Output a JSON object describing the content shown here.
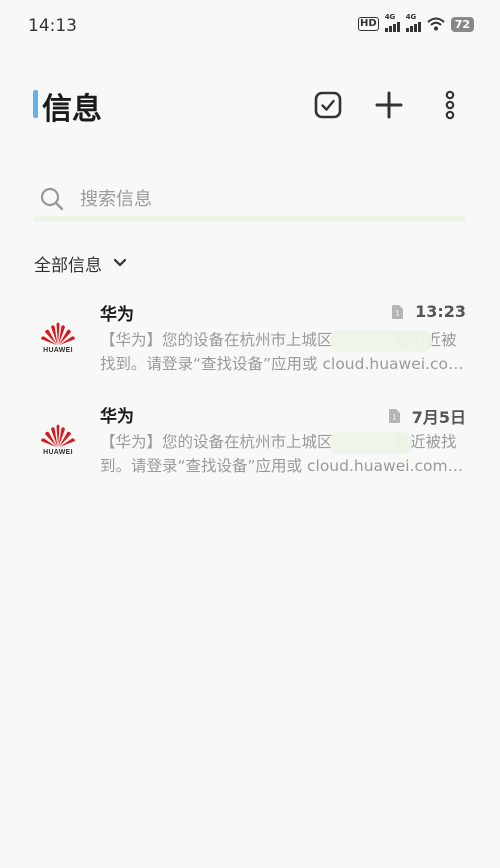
{
  "status_bar": {
    "time": "14:13",
    "hd_label": "HD",
    "network_1": "4G",
    "network_2": "4G",
    "battery": "72"
  },
  "header": {
    "title": "信息",
    "accent_color": "#5fb3e6",
    "actions": [
      {
        "name": "select",
        "icon": "check-square-icon"
      },
      {
        "name": "new",
        "icon": "plus-icon"
      },
      {
        "name": "more",
        "icon": "more-vertical-icon"
      }
    ]
  },
  "search": {
    "placeholder": "搜索信息",
    "value": ""
  },
  "filter": {
    "label": "全部信息"
  },
  "messages": [
    {
      "sender": "华为",
      "time": "13:23",
      "sim": "1",
      "preview": "【华为】您的设备在杭州市上城区　　　　街附近被找到。请登录“查找设备”应用或 cloud.huawei.com 查看",
      "logo_text": "HUAWEI"
    },
    {
      "sender": "华为",
      "time": "7月5日",
      "sim": "1",
      "preview": "【华为】您的设备在杭州市上城区　　　　附近被找到。请登录“查找设备”应用或 cloud.huawei.com 查看",
      "logo_text": "HUAWEI"
    }
  ]
}
